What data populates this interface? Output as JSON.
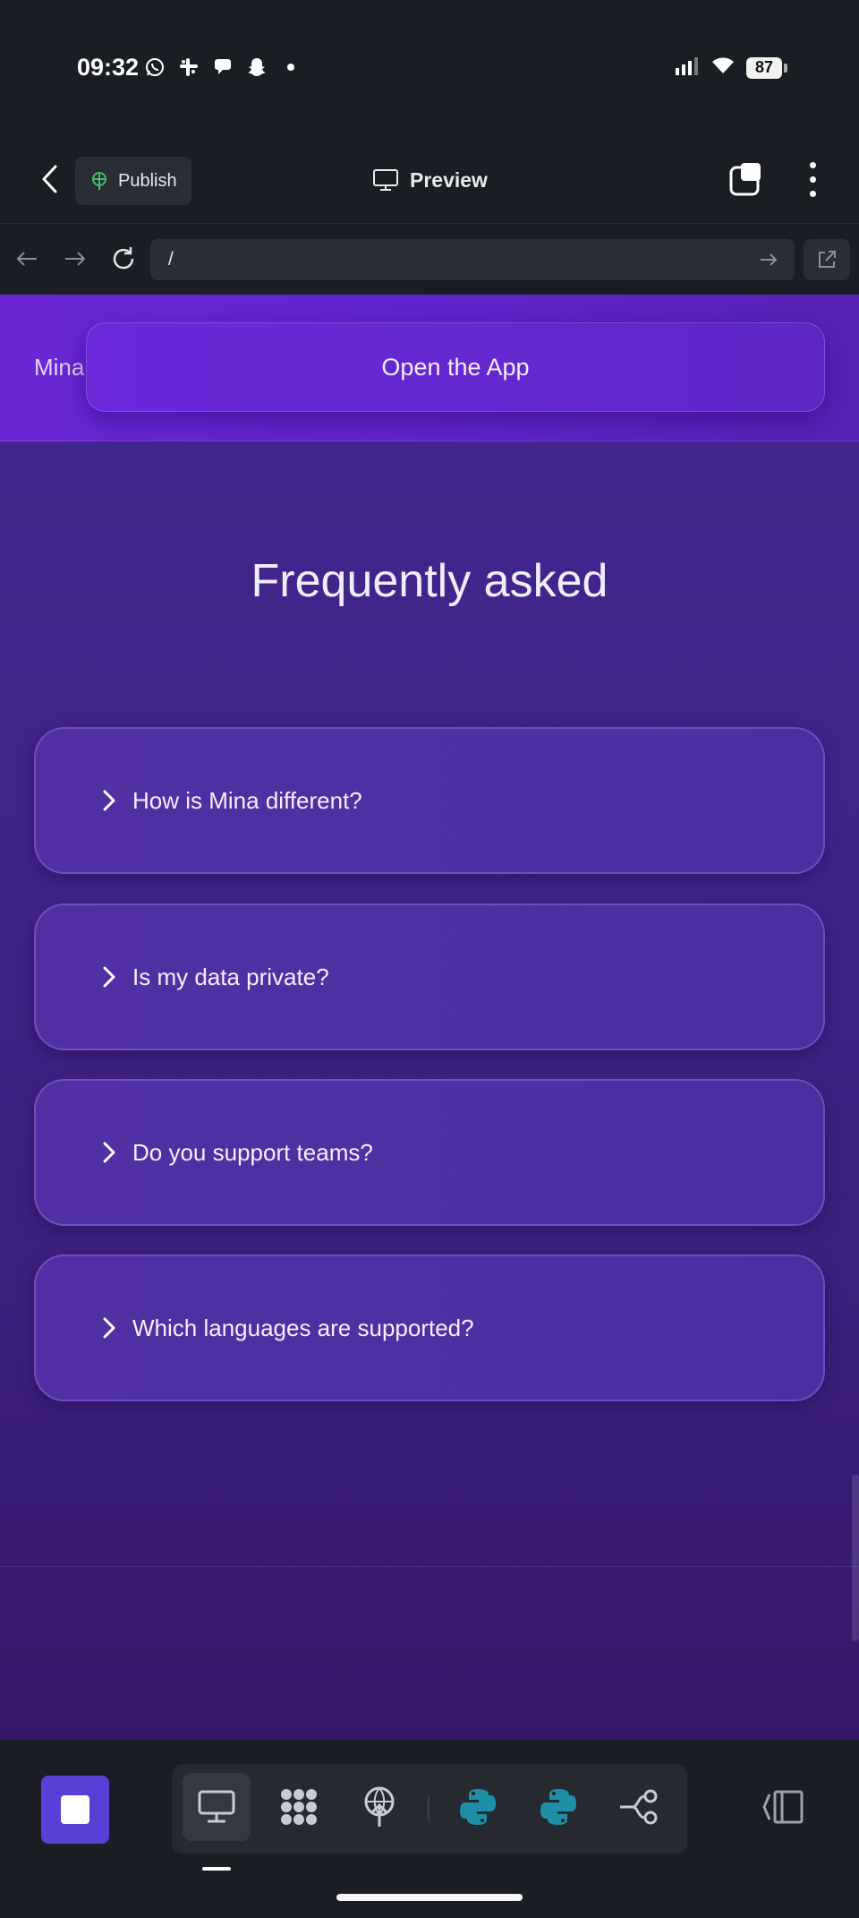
{
  "status_bar": {
    "time": "09:32",
    "notification_icons": [
      "whatsapp-icon",
      "slack-icon",
      "chat-bubble-icon",
      "snapchat-icon",
      "dot-icon"
    ],
    "battery": "87"
  },
  "toolbar": {
    "publish_label": "Publish",
    "preview_label": "Preview"
  },
  "address_bar": {
    "url": "/"
  },
  "site": {
    "brand": "Mina",
    "open_app_label": "Open the App",
    "faq_title": "Frequently asked",
    "faq_items": [
      {
        "question": "How is Mina different?"
      },
      {
        "question": "Is my data private?"
      },
      {
        "question": "Do you support teams?"
      },
      {
        "question": "Which languages are supported?"
      }
    ]
  },
  "colors": {
    "accent": "#5a3fd6",
    "header_purple": "#6a27d6",
    "page_purple": "#44278f",
    "python_teal": "#1d8fa6",
    "publish_green": "#3fbf6a"
  },
  "bottom_bar": {
    "tools": [
      "desktop-icon",
      "grid-icon",
      "deploy-icon",
      "python-icon",
      "python-icon",
      "workflow-icon"
    ]
  }
}
